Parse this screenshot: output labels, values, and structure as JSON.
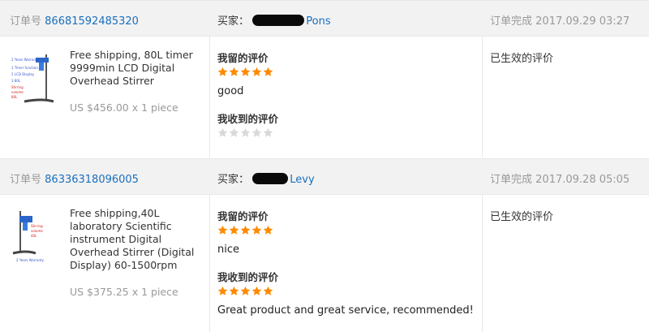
{
  "colors": {
    "link": "#1a6fbd",
    "star_filled": "#ff8a00",
    "star_empty": "#d9d9d9",
    "header_bg": "#f2f2f2"
  },
  "orders": [
    {
      "order_label": "订单号",
      "order_number": "86681592485320",
      "buyer_label": "买家：",
      "buyer_name": "Pons",
      "status_label": "订单完成",
      "completed_at": "2017.09.29 03:27",
      "product": {
        "title": "Free shipping, 80L timer 9999min LCD Digital Overhead Stirrer",
        "price": "US $456.00 x 1 piece",
        "thumb_icon": "stirrer-product-image"
      },
      "my_review": {
        "heading": "我留的评价",
        "rating": 5,
        "text": "good"
      },
      "received_review": {
        "heading": "我收到的评价",
        "rating": 0,
        "text": ""
      },
      "status": "已生效的评价"
    },
    {
      "order_label": "订单号",
      "order_number": "86336318096005",
      "buyer_label": "买家：",
      "buyer_name": "Levy",
      "status_label": "订单完成",
      "completed_at": "2017.09.28 05:05",
      "product": {
        "title": "Free shipping,40L laboratory Scientific instrument Digital Overhead Stirrer (Digital Display) 60-1500rpm",
        "price": "US $375.25 x 1 piece",
        "thumb_icon": "stirrer-product-image"
      },
      "my_review": {
        "heading": "我留的评价",
        "rating": 5,
        "text": "nice"
      },
      "received_review": {
        "heading": "我收到的评价",
        "rating": 5,
        "text": "Great product and great service, recommended!"
      },
      "status": "已生效的评价"
    }
  ]
}
